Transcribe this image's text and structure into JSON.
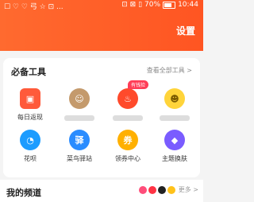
{
  "status_bar": {
    "carrier": "☐ ♡ ♡ 弓 ☆ ⊡ ...",
    "signal": "⊡ ⊠ ▯",
    "battery": "70%",
    "time": "10:44"
  },
  "header": {
    "settings_label": "设置"
  },
  "tools": {
    "title": "必备工具",
    "see_all": "查看全部工具 >",
    "items": [
      {
        "label": "每日返现",
        "icon": "calendar-gift-icon",
        "color": "#ff5a3a",
        "glyph": "▣"
      },
      {
        "label": "",
        "icon": "avatar-character-icon",
        "color": "#c49a6c",
        "glyph": "☺"
      },
      {
        "label": "",
        "icon": "flame-icon",
        "color": "#ff4a2b",
        "glyph": "🔥",
        "badge": "有钱捡"
      },
      {
        "label": "",
        "icon": "smiley-mascot-icon",
        "color": "#ffd43a",
        "glyph": "☻"
      },
      {
        "label": "花呗",
        "icon": "huabei-icon",
        "color": "#1c9cff",
        "glyph": "◔"
      },
      {
        "label": "菜鸟驿站",
        "icon": "cainiao-icon",
        "color": "#2a8cff",
        "glyph": "驿"
      },
      {
        "label": "领券中心",
        "icon": "coupon-icon",
        "color": "#ffb000",
        "glyph": "券"
      },
      {
        "label": "主题换肤",
        "icon": "theme-skin-icon",
        "color": "#7a5cff",
        "glyph": "◆"
      }
    ]
  },
  "channels": {
    "title": "我的频道",
    "more": "更多 >"
  }
}
